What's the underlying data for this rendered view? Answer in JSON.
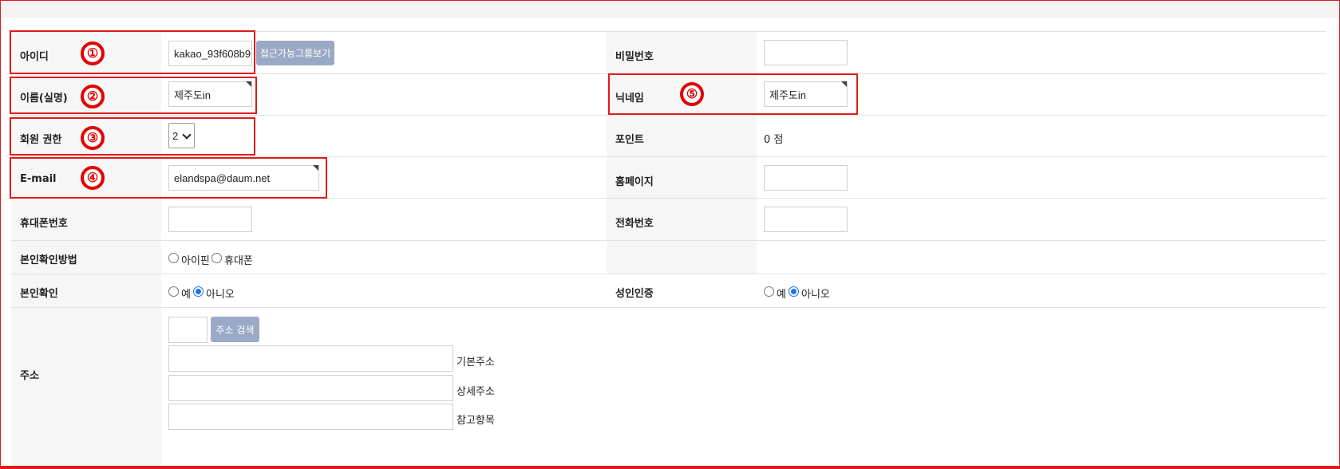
{
  "fields": {
    "id": {
      "label": "아이디",
      "value": "kakao_93f608b9",
      "button": "접근가능그룹보기"
    },
    "password": {
      "label": "비밀번호",
      "value": ""
    },
    "name": {
      "label": "이름(실명)",
      "value": "제주도in"
    },
    "nickname": {
      "label": "닉네임",
      "value": "제주도in"
    },
    "level": {
      "label": "회원 권한",
      "value": "2"
    },
    "point": {
      "label": "포인트",
      "value": "0 점"
    },
    "email": {
      "label": "E-mail",
      "value": "elandspa@daum.net"
    },
    "homepage": {
      "label": "홈페이지",
      "value": ""
    },
    "mobile": {
      "label": "휴대폰번호",
      "value": ""
    },
    "phone": {
      "label": "전화번호",
      "value": ""
    },
    "cert_method": {
      "label": "본인확인방법",
      "options": [
        "아이핀",
        "휴대폰"
      ],
      "selected": null
    },
    "cert": {
      "label": "본인확인",
      "options": [
        "예",
        "아니오"
      ],
      "selected": "아니오"
    },
    "adult": {
      "label": "성인인증",
      "options": [
        "예",
        "아니오"
      ],
      "selected": "아니오"
    },
    "address": {
      "label": "주소",
      "zip": "",
      "search_button": "주소 검색",
      "addr1_label": "기본주소",
      "addr2_label": "상세주소",
      "addr3_label": "참고항목"
    }
  },
  "annotations": [
    "①",
    "②",
    "③",
    "④",
    "⑤"
  ],
  "colors": {
    "highlight": "#e01b1b",
    "button": "#9aa9c5",
    "label_bg": "#f6f6f6",
    "radio_accent": "#1a73e8"
  }
}
